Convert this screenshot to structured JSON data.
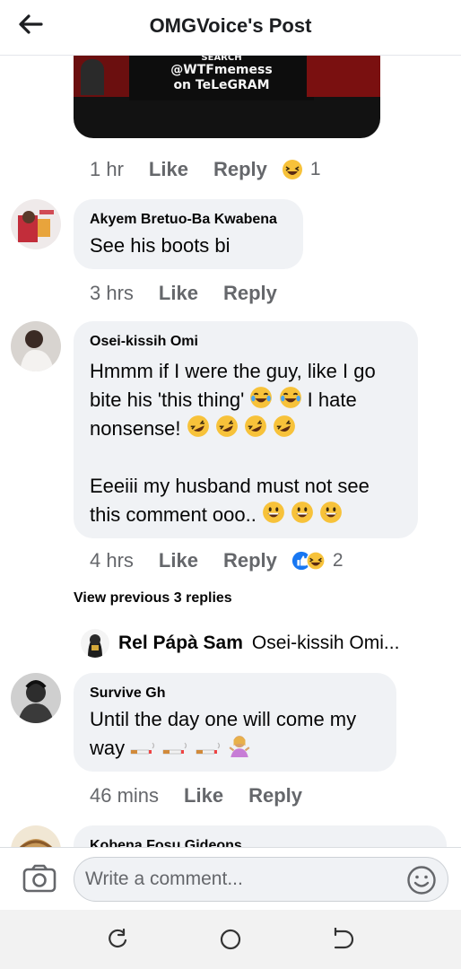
{
  "header": {
    "title": "OMGVoice's Post"
  },
  "media": {
    "line1": "SEARCH",
    "line2": "@WTFmemess",
    "line3": "on TeLeGRAM"
  },
  "post_actions": {
    "time": "1 hr",
    "like": "Like",
    "reply": "Reply",
    "reaction_count": "1"
  },
  "comments": [
    {
      "author": "Akyem Bretuo-Ba Kwabena",
      "text": "See his boots bi",
      "time": "3 hrs",
      "like": "Like",
      "reply": "Reply"
    },
    {
      "author": "Osei-kissih Omi",
      "line1": "Hmmm if I were the guy, like I go",
      "line2a": "bite his 'this thing'",
      "line2b": "I hate",
      "line3": "nonsense!",
      "line4": "Eeeiii my husband must not see",
      "line5": "this comment ooo..",
      "time": "4 hrs",
      "like": "Like",
      "reply": "Reply",
      "reaction_count": "2"
    },
    {
      "author": "Survive Gh",
      "line1": "Until the day one will come my",
      "line2": "way",
      "time": "46 mins",
      "like": "Like",
      "reply": "Reply"
    },
    {
      "author": "Kobena Fosu Gideons"
    }
  ],
  "replies": {
    "view_previous": "View previous 3 replies",
    "latest_author": "Rel Pápà Sam",
    "latest_text": "Osei-kissih Omi..."
  },
  "composer": {
    "placeholder": "Write a comment..."
  },
  "colors": {
    "meta_gray": "#65676b",
    "bubble_bg": "#f0f2f5",
    "like_blue": "#1877f2"
  }
}
